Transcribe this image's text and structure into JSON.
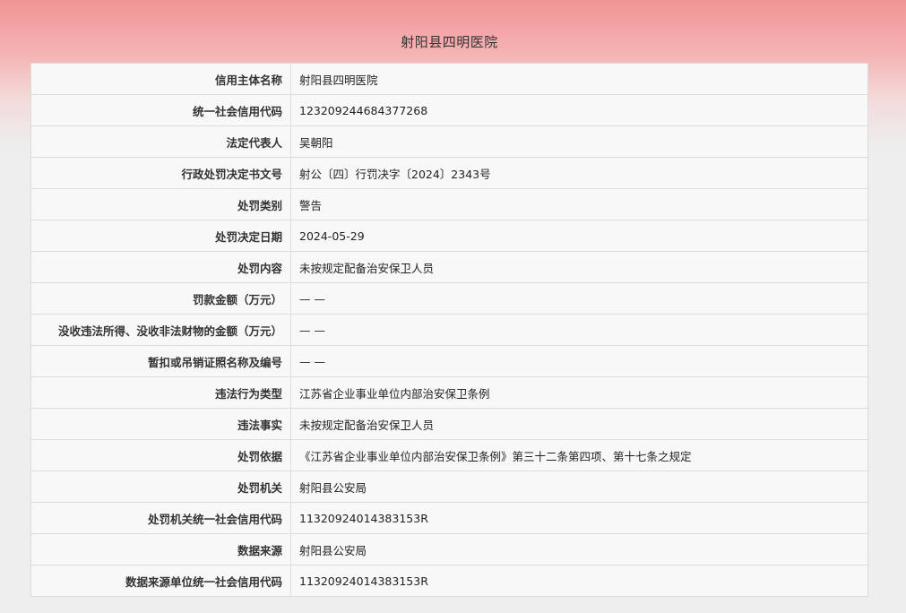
{
  "page": {
    "title": "射阳县四明医院"
  },
  "rows": [
    {
      "label": "信用主体名称",
      "value": "射阳县四明医院"
    },
    {
      "label": "统一社会信用代码",
      "value": "123209244684377268"
    },
    {
      "label": "法定代表人",
      "value": "吴朝阳"
    },
    {
      "label": "行政处罚决定书文号",
      "value": "射公〔四〕行罚决字〔2024〕2343号"
    },
    {
      "label": "处罚类别",
      "value": "警告"
    },
    {
      "label": "处罚决定日期",
      "value": "2024-05-29"
    },
    {
      "label": "处罚内容",
      "value": "未按规定配备治安保卫人员"
    },
    {
      "label": "罚款金额（万元）",
      "value": "— —"
    },
    {
      "label": "没收违法所得、没收非法财物的金额（万元）",
      "value": "— —"
    },
    {
      "label": "暂扣或吊销证照名称及编号",
      "value": "— —"
    },
    {
      "label": "违法行为类型",
      "value": "江苏省企业事业单位内部治安保卫条例"
    },
    {
      "label": "违法事实",
      "value": "未按规定配备治安保卫人员"
    },
    {
      "label": "处罚依据",
      "value": "《江苏省企业事业单位内部治安保卫条例》第三十二条第四项、第十七条之规定"
    },
    {
      "label": "处罚机关",
      "value": "射阳县公安局"
    },
    {
      "label": "处罚机关统一社会信用代码",
      "value": "11320924014383153R"
    },
    {
      "label": "数据来源",
      "value": "射阳县公安局"
    },
    {
      "label": "数据来源单位统一社会信用代码",
      "value": "11320924014383153R"
    }
  ]
}
